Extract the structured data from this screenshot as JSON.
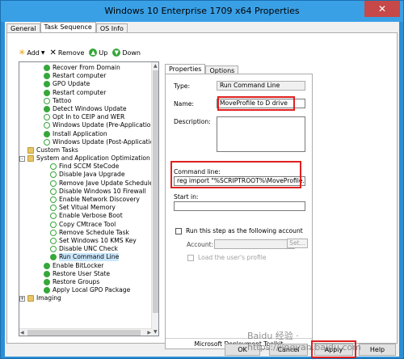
{
  "window": {
    "title": "Windows 10 Enterprise 1709 x64 Properties",
    "close_glyph": "✕"
  },
  "outer_tabs": [
    "General",
    "Task Sequence",
    "OS Info"
  ],
  "toolbar": {
    "add": "Add",
    "remove": "Remove",
    "up": "Up",
    "down": "Down"
  },
  "tree": [
    {
      "label": "Recover From Domain",
      "icon": "check-icon",
      "level": 2
    },
    {
      "label": "Restart computer",
      "icon": "check-icon",
      "level": 2
    },
    {
      "label": "GPO Update",
      "icon": "check-icon",
      "level": 2
    },
    {
      "label": "Restart computer",
      "icon": "check-icon",
      "level": 2
    },
    {
      "label": "Tattoo",
      "icon": "check-outline-icon",
      "level": 2
    },
    {
      "label": "Detect Windows Update",
      "icon": "check-icon",
      "level": 2
    },
    {
      "label": "Opt In to CEIP and WER",
      "icon": "check-outline-icon",
      "level": 2
    },
    {
      "label": "Windows Update (Pre-Application Inst",
      "icon": "check-outline-icon",
      "level": 2
    },
    {
      "label": "Install Application",
      "icon": "check-icon",
      "level": 2
    },
    {
      "label": "Windows Update (Post-Application Ins",
      "icon": "check-outline-icon",
      "level": 2
    },
    {
      "label": "Custom Tasks",
      "icon": "folder-icon",
      "level": 1
    },
    {
      "label": "System and Application Optimization",
      "icon": "folder-icon",
      "level": 1,
      "expander": "-"
    },
    {
      "label": "Find SCCM SteCode",
      "icon": "check-outline-icon",
      "level": 3
    },
    {
      "label": "Disable Java Upgrade",
      "icon": "check-outline-icon",
      "level": 3
    },
    {
      "label": "Remove Jave Update Schedule F",
      "icon": "check-outline-icon",
      "level": 3
    },
    {
      "label": "Disable Windows 10 Firewall",
      "icon": "check-outline-icon",
      "level": 3
    },
    {
      "label": "Enable Network Discovery",
      "icon": "check-outline-icon",
      "level": 3
    },
    {
      "label": "Set Vitual Memory",
      "icon": "check-outline-icon",
      "level": 3
    },
    {
      "label": "Enable Verbose Boot",
      "icon": "check-outline-icon",
      "level": 3
    },
    {
      "label": "Copy CMtrace Tool",
      "icon": "check-outline-icon",
      "level": 3
    },
    {
      "label": "Remove Schedule Task",
      "icon": "check-outline-icon",
      "level": 3
    },
    {
      "label": "Set Windows 10 KMS Key",
      "icon": "check-outline-icon",
      "level": 3
    },
    {
      "label": "Disable UNC Check",
      "icon": "check-outline-icon",
      "level": 3
    },
    {
      "label": "Run Command Line",
      "icon": "check-icon",
      "level": 3,
      "selected": true
    },
    {
      "label": "Enable BitLocker",
      "icon": "check-icon",
      "level": 2
    },
    {
      "label": "Restore User State",
      "icon": "check-icon",
      "level": 2
    },
    {
      "label": "Restore Groups",
      "icon": "check-icon",
      "level": 2
    },
    {
      "label": "Apply Local GPO Package",
      "icon": "check-icon",
      "level": 2
    },
    {
      "label": "Imaging",
      "icon": "folder-icon",
      "level": 1,
      "expander": "+"
    }
  ],
  "right_tabs": [
    "Properties",
    "Options"
  ],
  "properties": {
    "type_label": "Type:",
    "type_value": "Run Command Line",
    "name_label": "Name:",
    "name_value": "MoveProfile to D drive",
    "description_label": "Description:",
    "description_value": "",
    "command_line_label": "Command line:",
    "command_line_value": "reg import \"%SCRIPTROOT%\\MoveProfile.reg\"",
    "start_in_label": "Start in:",
    "start_in_value": "",
    "run_as_label": "Run this step as the following account",
    "account_label": "Account:",
    "account_value": "",
    "set_button": "Set...",
    "load_profile_label": "Load the user's profile",
    "footer": "Microsoft Deployment Toolkit"
  },
  "buttons": {
    "ok": "OK",
    "cancel": "Cancel",
    "apply": "Apply",
    "help": "Help"
  },
  "watermark": "Baidu 经验 · https://jingyan.baidu.com",
  "colors": {
    "title_bar": "#39a0e6",
    "highlight_box": "#e02020",
    "step_ok": "#37a73a",
    "selection": "#cce8ff"
  }
}
